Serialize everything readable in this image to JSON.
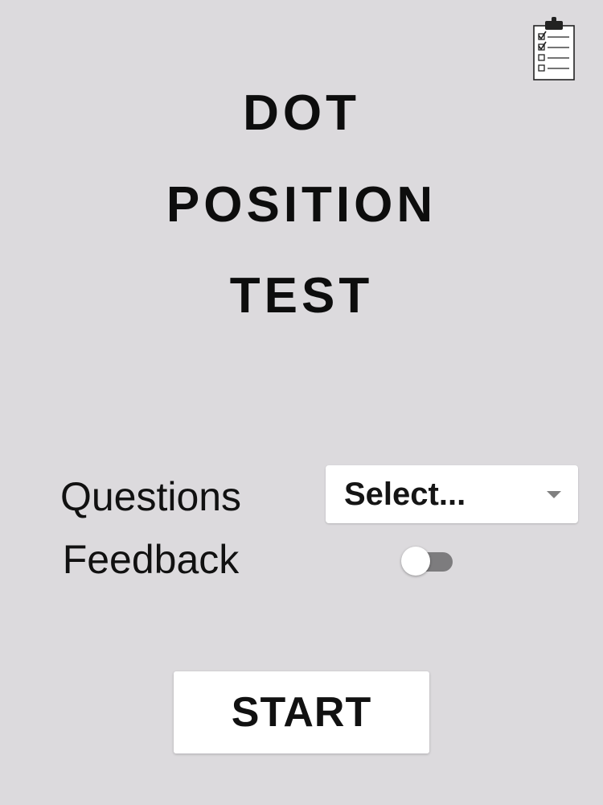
{
  "header": {
    "clipboard_icon": "clipboard-checklist-icon"
  },
  "title": {
    "line1": "DOT",
    "line2": "POSITION",
    "line3": "TEST"
  },
  "settings": {
    "questions_label": "Questions",
    "questions_select_value": "Select...",
    "feedback_label": "Feedback",
    "feedback_enabled": false
  },
  "start_button": {
    "label": "START"
  },
  "colors": {
    "background": "#dcdadd",
    "text": "#111111",
    "toggle_track": "#7d7c7e",
    "surface": "#ffffff"
  }
}
